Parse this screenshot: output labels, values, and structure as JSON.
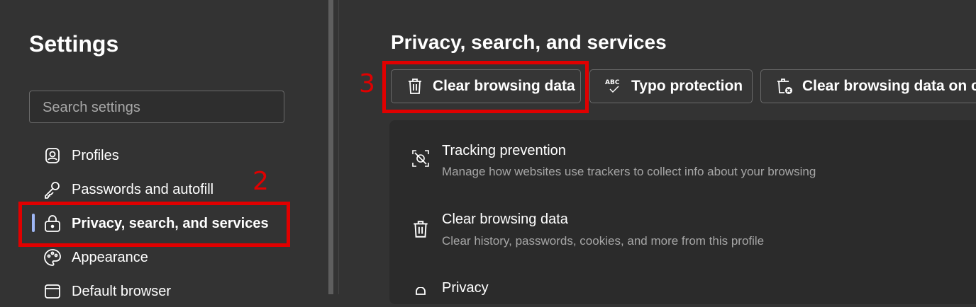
{
  "sidebar": {
    "title": "Settings",
    "search_placeholder": "Search settings",
    "items": [
      {
        "label": "Profiles",
        "icon": "profile-icon"
      },
      {
        "label": "Passwords and autofill",
        "icon": "key-icon"
      },
      {
        "label": "Privacy, search, and services",
        "icon": "lock-icon",
        "active": true
      },
      {
        "label": "Appearance",
        "icon": "palette-icon"
      },
      {
        "label": "Default browser",
        "icon": "browser-icon"
      }
    ]
  },
  "main": {
    "page_title": "Privacy, search, and services",
    "quick_actions": [
      {
        "label": "Clear browsing data",
        "icon": "trash-icon"
      },
      {
        "label": "Typo protection",
        "icon": "abc-check-icon"
      },
      {
        "label": "Clear browsing data on close",
        "icon": "trash-x-icon"
      }
    ],
    "rows": [
      {
        "title": "Tracking prevention",
        "desc": "Manage how websites use trackers to collect info about your browsing",
        "icon": "tracking-icon"
      },
      {
        "title": "Clear browsing data",
        "desc": "Clear history, passwords, cookies, and more from this profile",
        "icon": "trash-icon"
      },
      {
        "title": "Privacy",
        "desc": "",
        "icon": "privacy-icon"
      }
    ]
  },
  "annotations": {
    "step2": "2",
    "step3": "3"
  },
  "colors": {
    "background": "#333333",
    "annotation": "#e00000",
    "active_indicator": "#9fb7f5"
  }
}
